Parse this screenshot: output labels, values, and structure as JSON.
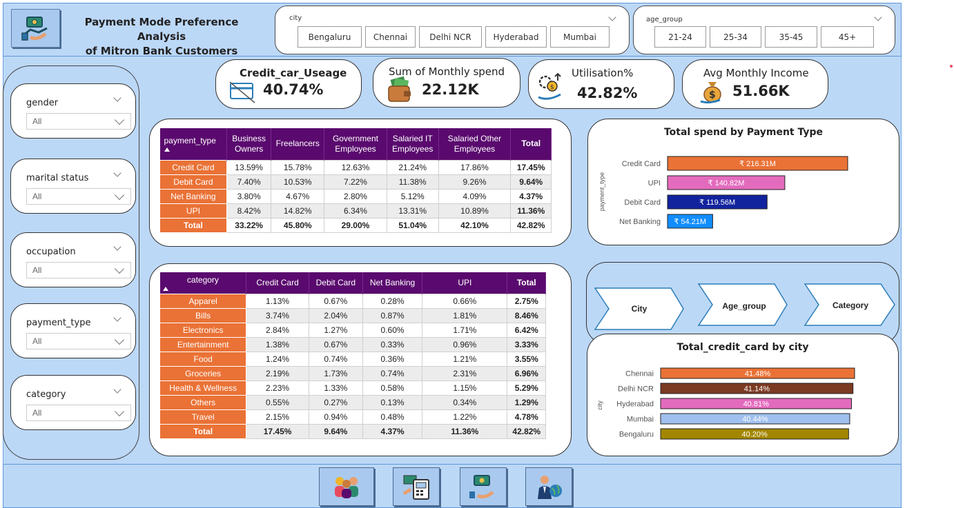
{
  "header": {
    "title_line1": "Payment Mode Preference Analysis",
    "title_line2": "of Mitron Bank Customers"
  },
  "city_slicer": {
    "label": "city",
    "options": [
      "Bengaluru",
      "Chennai",
      "Delhi NCR",
      "Hyderabad",
      "Mumbai"
    ]
  },
  "age_slicer": {
    "label": "age_group",
    "options": [
      "21-24",
      "25-34",
      "35-45",
      "45+"
    ]
  },
  "left_slicers": [
    {
      "label": "gender",
      "value": "All"
    },
    {
      "label": "marital status",
      "value": "All"
    },
    {
      "label": "occupation",
      "value": "All"
    },
    {
      "label": "payment_type",
      "value": "All"
    },
    {
      "label": "category",
      "value": "All"
    }
  ],
  "kpis": [
    {
      "label": "Credit_car_Useage",
      "value": "40.74%",
      "icon": "credit-card-icon"
    },
    {
      "label": "Sum of Monthly spend",
      "value": "22.12K",
      "icon": "wallet-icon"
    },
    {
      "label": "Utilisation%",
      "value": "42.82%",
      "icon": "utilisation-icon"
    },
    {
      "label": "Avg Monthly Income",
      "value": "51.66K",
      "icon": "money-bag-icon"
    }
  ],
  "occupation_table": {
    "headers": [
      "payment_type",
      "Business Owners",
      "Freelancers",
      "Government Employees",
      "Salaried IT Employees",
      "Salaried Other Employees",
      "Total"
    ],
    "rows": [
      [
        "Credit Card",
        "13.59%",
        "15.78%",
        "12.63%",
        "21.24%",
        "17.86%",
        "17.45%"
      ],
      [
        "Debit Card",
        "7.40%",
        "10.53%",
        "7.22%",
        "11.38%",
        "9.26%",
        "9.64%"
      ],
      [
        "Net Banking",
        "3.80%",
        "4.67%",
        "2.80%",
        "5.12%",
        "4.09%",
        "4.37%"
      ],
      [
        "UPI",
        "8.42%",
        "14.82%",
        "6.34%",
        "13.31%",
        "10.89%",
        "11.36%"
      ],
      [
        "Total",
        "33.22%",
        "45.80%",
        "29.00%",
        "51.04%",
        "42.10%",
        "42.82%"
      ]
    ]
  },
  "category_table": {
    "headers": [
      "category",
      "Credit Card",
      "Debit Card",
      "Net Banking",
      "UPI",
      "Total"
    ],
    "rows": [
      [
        "Apparel",
        "1.13%",
        "0.67%",
        "0.28%",
        "0.66%",
        "2.75%"
      ],
      [
        "Bills",
        "3.74%",
        "2.04%",
        "0.87%",
        "1.81%",
        "8.46%"
      ],
      [
        "Electronics",
        "2.84%",
        "1.27%",
        "0.60%",
        "1.71%",
        "6.42%"
      ],
      [
        "Entertainment",
        "1.38%",
        "0.67%",
        "0.33%",
        "0.96%",
        "3.33%"
      ],
      [
        "Food",
        "1.24%",
        "0.74%",
        "0.36%",
        "1.21%",
        "3.55%"
      ],
      [
        "Groceries",
        "2.19%",
        "1.73%",
        "0.74%",
        "2.31%",
        "6.96%"
      ],
      [
        "Health & Wellness",
        "2.23%",
        "1.33%",
        "0.58%",
        "1.15%",
        "5.29%"
      ],
      [
        "Others",
        "0.55%",
        "0.27%",
        "0.13%",
        "0.34%",
        "1.29%"
      ],
      [
        "Travel",
        "2.15%",
        "0.94%",
        "0.48%",
        "1.22%",
        "4.78%"
      ],
      [
        "Total",
        "17.45%",
        "9.64%",
        "4.37%",
        "11.36%",
        "42.82%"
      ]
    ]
  },
  "drill_steps": [
    "City",
    "Age_group",
    "Category"
  ],
  "chart_data": [
    {
      "type": "bar",
      "orientation": "horizontal",
      "title": "Total spend by Payment Type",
      "ylabel": "payment_type",
      "categories": [
        "Credit Card",
        "UPI",
        "Debit Card",
        "Net Banking"
      ],
      "values": [
        216.31,
        140.82,
        119.56,
        54.21
      ],
      "labels": [
        "₹ 216.31M",
        "₹ 140.82M",
        "₹ 119.56M",
        "₹ 54.21M"
      ],
      "colors": [
        "#ea7236",
        "#e36bbd",
        "#12239e",
        "#118dff"
      ],
      "xlim": [
        0,
        216.31
      ]
    },
    {
      "type": "bar",
      "orientation": "horizontal",
      "title": "Total_credit_card by city",
      "ylabel": "city",
      "categories": [
        "Chennai",
        "Delhi NCR",
        "Hyderabad",
        "Mumbai",
        "Bengaluru"
      ],
      "values": [
        41.48,
        41.14,
        40.81,
        40.44,
        40.2
      ],
      "labels": [
        "41.48%",
        "41.14%",
        "40.81%",
        "40.44%",
        "40.20%"
      ],
      "colors": [
        "#ea7236",
        "#7b3a22",
        "#e36bbd",
        "#a0c0ef",
        "#a38600"
      ],
      "xlim": [
        0,
        41.48
      ]
    }
  ],
  "nav_buttons": [
    "customers-icon",
    "payment-terminal-icon",
    "payment-handshake-icon",
    "businessman-globe-icon"
  ]
}
